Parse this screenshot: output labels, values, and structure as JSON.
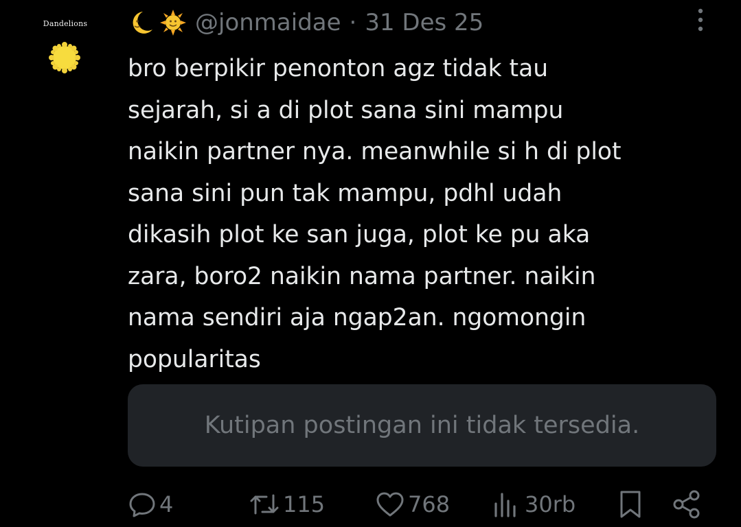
{
  "avatar": {
    "label": "Dandelions"
  },
  "tweet": {
    "handle": "@jonmaidae",
    "separator": "·",
    "date": "31 Des 25",
    "text": "bro berpikir penonton agz tidak tau\nsejarah, si a di plot sana sini mampu\nnaikin partner nya. meanwhile si h di plot\nsana sini pun tak mampu, pdhl udah\ndikasih plot ke san juga, plot ke pu aka\nzara, boro2 naikin nama partner. naikin\nnama sendiri aja ngap2an. ngomongin\npopularitas",
    "quote_unavailable": "Kutipan postingan ini tidak tersedia."
  },
  "actions": {
    "replies": "4",
    "reposts": "115",
    "likes": "768",
    "views": "30rb"
  },
  "icons": [
    "moon-emoji-icon",
    "sun-emoji-icon",
    "more-vertical-icon",
    "reply-icon",
    "repost-icon",
    "like-icon",
    "views-icon",
    "bookmark-icon",
    "share-icon"
  ],
  "colors": {
    "background": "#000000",
    "text": "#e7e9ea",
    "muted": "#71767b",
    "quote_bg": "#202327"
  }
}
